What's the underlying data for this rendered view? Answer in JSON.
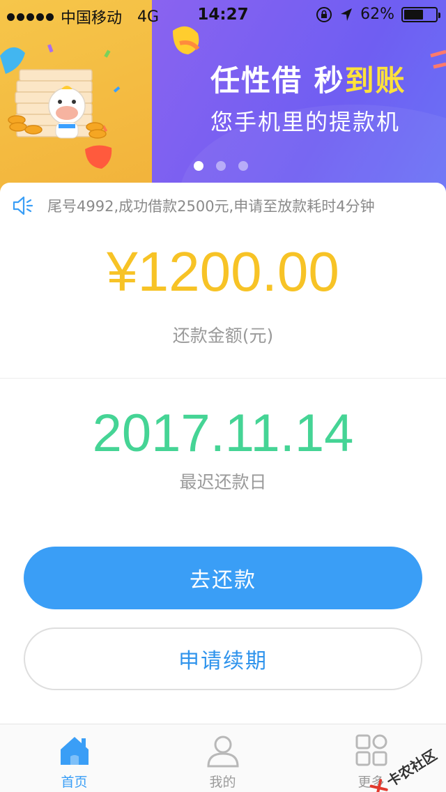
{
  "status_bar": {
    "carrier": "中国移动",
    "network": "4G",
    "time": "14:27",
    "battery": "62%",
    "battery_level": 0.62
  },
  "banner": {
    "title_part1": "任性借 秒",
    "title_part2": "到账",
    "subtitle": "您手机里的提款机",
    "active_slide": 1,
    "slide_count": 3
  },
  "notice": {
    "text": "尾号4992,成功借款2500元,申请至放款耗时4分钟"
  },
  "repayment": {
    "amount": "¥1200.00",
    "amount_label": "还款金额(元)",
    "due_date": "2017.11.14",
    "due_label": "最迟还款日"
  },
  "actions": {
    "repay_label": "去还款",
    "extend_label": "申请续期"
  },
  "tabbar": {
    "tabs": [
      {
        "label": "首页",
        "icon": "home-icon",
        "active": true
      },
      {
        "label": "我的",
        "icon": "user-icon",
        "active": false
      },
      {
        "label": "更多",
        "icon": "grid-icon",
        "active": false
      }
    ]
  },
  "watermark": {
    "text": "卡农社区"
  },
  "colors": {
    "accent": "#3a9ef6",
    "amount": "#f7c326",
    "date": "#45d495",
    "banner_purple": "#7a60f0",
    "banner_yellow": "#f6c64a"
  }
}
